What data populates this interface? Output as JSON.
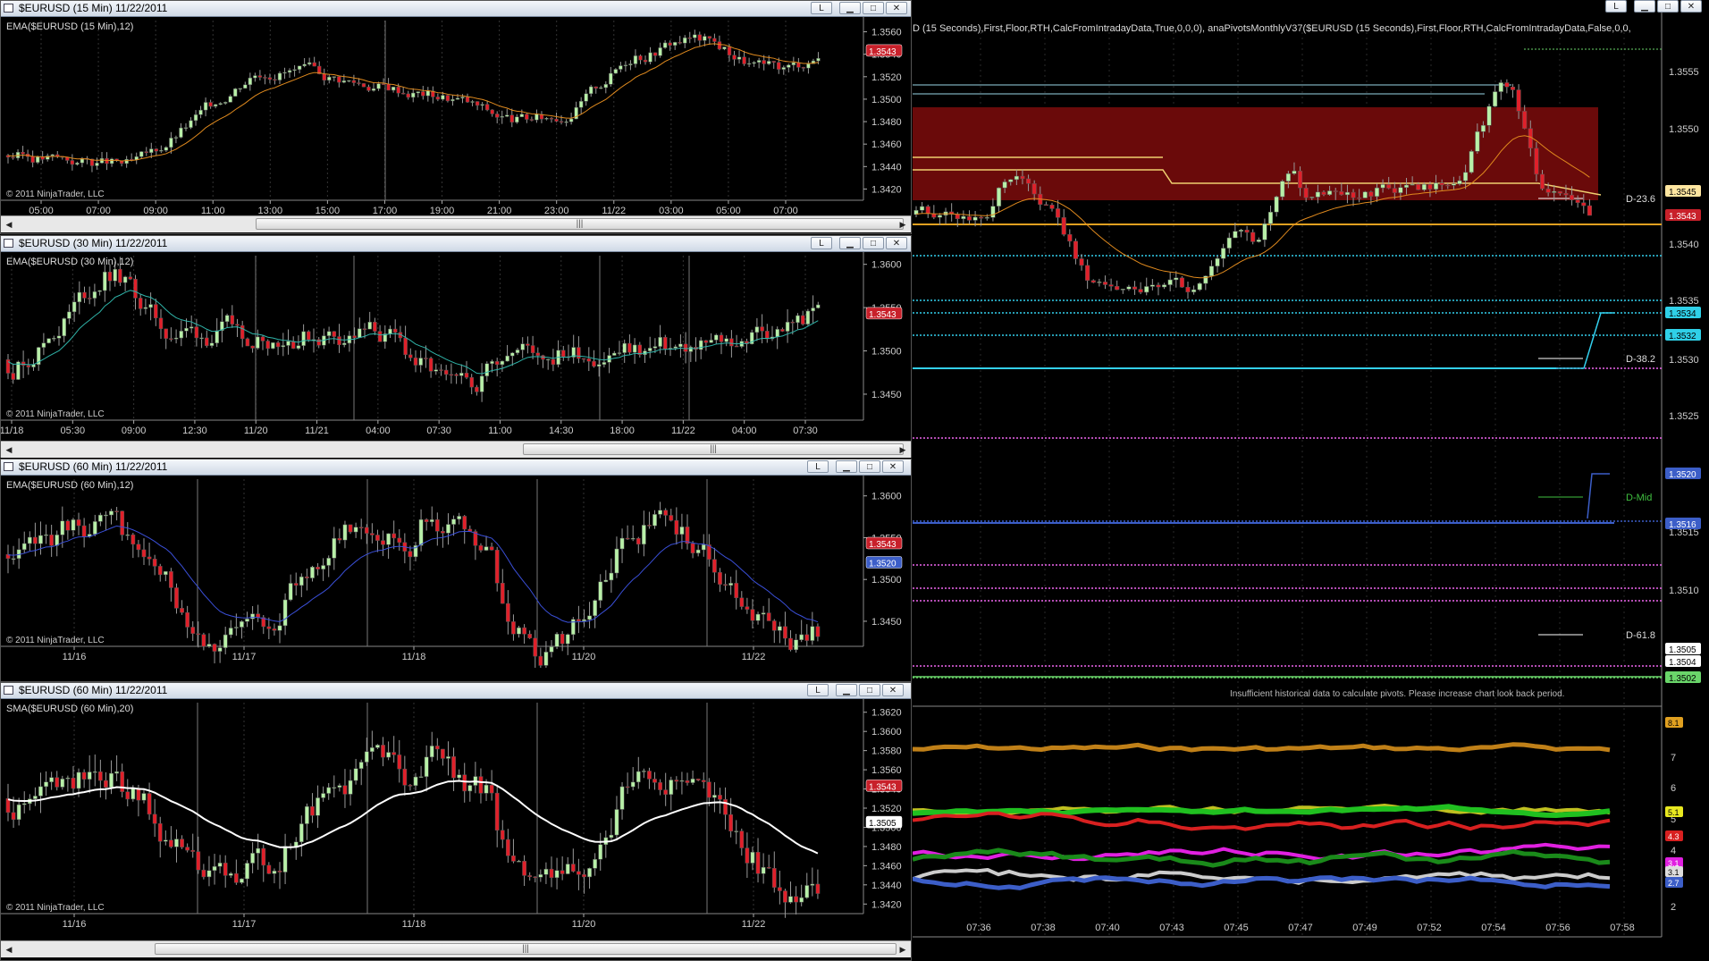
{
  "windows": [
    {
      "title": "$EURUSD (15 Min)  11/22/2011",
      "indicator": "EMA($EURUSD (15 Min),12)",
      "copyright": "© 2011 NinjaTrader, LLC",
      "y_ticks": [
        "1.3560",
        "1.3540",
        "1.3520",
        "1.3500",
        "1.3480",
        "1.3460",
        "1.3440",
        "1.3420"
      ],
      "x_ticks": [
        "05:00",
        "07:00",
        "09:00",
        "11:00",
        "13:00",
        "15:00",
        "17:00",
        "19:00",
        "21:00",
        "23:00",
        "11/22",
        "03:00",
        "05:00",
        "07:00"
      ],
      "price_label": "1.3543",
      "ylim": [
        1.341,
        1.357
      ],
      "ma_color": "#e08a1e"
    },
    {
      "title": "$EURUSD (30 Min)  11/22/2011",
      "indicator": "EMA($EURUSD (30 Min),12)",
      "copyright": "© 2011 NinjaTrader, LLC",
      "y_ticks": [
        "1.3600",
        "1.3550",
        "1.3500",
        "1.3450"
      ],
      "x_ticks": [
        "11/18",
        "05:30",
        "09:00",
        "12:30",
        "11/20",
        "11/21",
        "04:00",
        "07:30",
        "11:00",
        "14:30",
        "18:00",
        "11/22",
        "04:00",
        "07:30"
      ],
      "price_label": "1.3543",
      "ylim": [
        1.342,
        1.361
      ],
      "ma_color": "#2fb3a8"
    },
    {
      "title": "$EURUSD (60 Min)  11/22/2011",
      "indicator": "EMA($EURUSD (60 Min),12)",
      "copyright": "© 2011 NinjaTrader, LLC",
      "y_ticks": [
        "1.3600",
        "1.3550",
        "1.3500",
        "1.3450"
      ],
      "x_ticks": [
        "11/16",
        "11/17",
        "11/18",
        "11/20",
        "11/22"
      ],
      "price_label": "1.3543",
      "price_label2": "1.3520",
      "ylim": [
        1.342,
        1.362
      ],
      "ma_color": "#3a4fd8"
    },
    {
      "title": "$EURUSD (60 Min)  11/22/2011",
      "indicator": "SMA($EURUSD (60 Min),20)",
      "copyright": "© 2011 NinjaTrader, LLC",
      "y_ticks": [
        "1.3620",
        "1.3600",
        "1.3580",
        "1.3560",
        "1.3540",
        "1.3520",
        "1.3500",
        "1.3480",
        "1.3460",
        "1.3440",
        "1.3420"
      ],
      "x_ticks": [
        "11/16",
        "11/17",
        "11/18",
        "11/20",
        "11/22"
      ],
      "price_label": "1.3543",
      "price_label2": "1.3505",
      "ylim": [
        1.341,
        1.363
      ],
      "ma_color": "#ffffff"
    }
  ],
  "right_chart": {
    "header_text": "D (15 Seconds),First,Floor,RTH,CalcFromIntradayData,True,0,0,0), anaPivotsMonthlyV37($EURUSD (15 Seconds),First,Floor,RTH,CalcFromIntradayData,False,0,0,",
    "y_ticks": [
      "1.3555",
      "1.3550",
      "1.3540",
      "1.3535",
      "1.3530",
      "1.3525",
      "1.3515",
      "1.3510"
    ],
    "price_labels": [
      {
        "text": "1.3545",
        "color": "#ffe6a0",
        "fg": "#000"
      },
      {
        "text": "1.3543",
        "color": "#c8202a",
        "fg": "#fff"
      },
      {
        "text": "1.3534",
        "color": "#2fd0e8",
        "fg": "#000"
      },
      {
        "text": "1.3532",
        "color": "#2fd0e8",
        "fg": "#000"
      },
      {
        "text": "1.3520",
        "color": "#3c5ec8",
        "fg": "#fff"
      },
      {
        "text": "1.3516",
        "color": "#3c5ec8",
        "fg": "#fff"
      },
      {
        "text": "1.3505",
        "color": "#ffffff",
        "fg": "#000"
      },
      {
        "text": "1.3504",
        "color": "#ffffff",
        "fg": "#000"
      },
      {
        "text": "1.3502",
        "color": "#6ad66a",
        "fg": "#000"
      }
    ],
    "fib_labels": [
      "D-23.6",
      "D-38.2",
      "D-Mid",
      "D-61.8"
    ],
    "insufficient_text": "Insufficient historical data to calculate pivots. Please increase chart look back period.",
    "x_ticks": [
      "07:36",
      "07:38",
      "07:40",
      "07:43",
      "07:45",
      "07:47",
      "07:49",
      "07:52",
      "07:54",
      "07:56",
      "07:58"
    ],
    "osc_ticks": [
      "7",
      "6",
      "5",
      "4",
      "3",
      "2"
    ],
    "osc_labels": [
      {
        "text": "8.1",
        "color": "#e0a020",
        "fg": "#000"
      },
      {
        "text": "5.1",
        "color": "#e8e820",
        "fg": "#000"
      },
      {
        "text": "4.3",
        "color": "#d82020",
        "fg": "#fff"
      },
      {
        "text": "3.1",
        "color": "#e020e0",
        "fg": "#fff"
      },
      {
        "text": "3.1",
        "color": "#dddddd",
        "fg": "#000"
      },
      {
        "text": "2.7",
        "color": "#3c5ec8",
        "fg": "#fff"
      }
    ]
  }
}
